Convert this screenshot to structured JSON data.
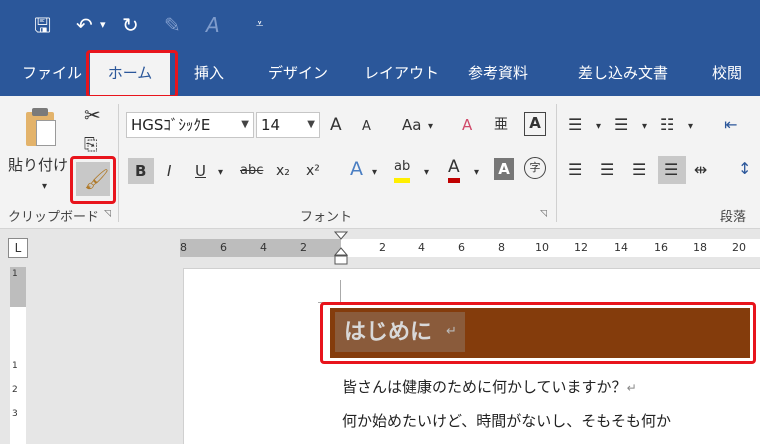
{
  "colors": {
    "titlebar": "#2b579a",
    "ribbon": "#f3f3f3",
    "heading_fill": "#843c0c",
    "highlight": "#e8141c"
  },
  "quick_access": [
    {
      "name": "save-icon",
      "glyph": "🖫"
    },
    {
      "name": "undo-icon",
      "glyph": "↶"
    },
    {
      "name": "undo-dropdown-icon",
      "glyph": "▾"
    },
    {
      "name": "redo-icon",
      "glyph": "↻"
    },
    {
      "name": "format-icon",
      "glyph": "✎"
    },
    {
      "name": "font-a-icon",
      "glyph": "A"
    },
    {
      "name": "customize-qat-icon",
      "glyph": "⩡"
    }
  ],
  "tabs": [
    "ファイル",
    "ホーム",
    "挿入",
    "デザイン",
    "レイアウト",
    "参考資料",
    "差し込み文書",
    "校閲"
  ],
  "active_tab": "ホーム",
  "clipboard": {
    "paste_label": "貼り付け",
    "group_label": "クリップボード"
  },
  "font": {
    "name": "HGSｺﾞｼｯｸE",
    "size": "14",
    "group_label": "フォント",
    "grow": "A",
    "shrink": "A",
    "case": "Aa",
    "clear": "A",
    "phonetic": "亜",
    "border": "A",
    "bold": "B",
    "italic": "I",
    "underline": "U",
    "strike": "abc",
    "sub": "x₂",
    "sup": "x²",
    "effects": "A",
    "highlight": "ab",
    "color": "A",
    "shading": "A",
    "enclose": "字"
  },
  "paragraph": {
    "group_label": "段落"
  },
  "ruler": {
    "corner": "L",
    "left_numbers": [
      "8",
      "6",
      "4",
      "2"
    ],
    "right_numbers": [
      "2",
      "4",
      "6",
      "8",
      "10",
      "12",
      "14",
      "16",
      "18",
      "20"
    ],
    "vertical_numbers": [
      "1",
      "1",
      "2",
      "3"
    ]
  },
  "document": {
    "heading": "はじめに",
    "heading_mark": "↵",
    "line1": "皆さんは健康のために何かしていますか？",
    "line1_mark": "↵",
    "line2": "何か始めたいけど、時間がないし、そもそも何か"
  }
}
